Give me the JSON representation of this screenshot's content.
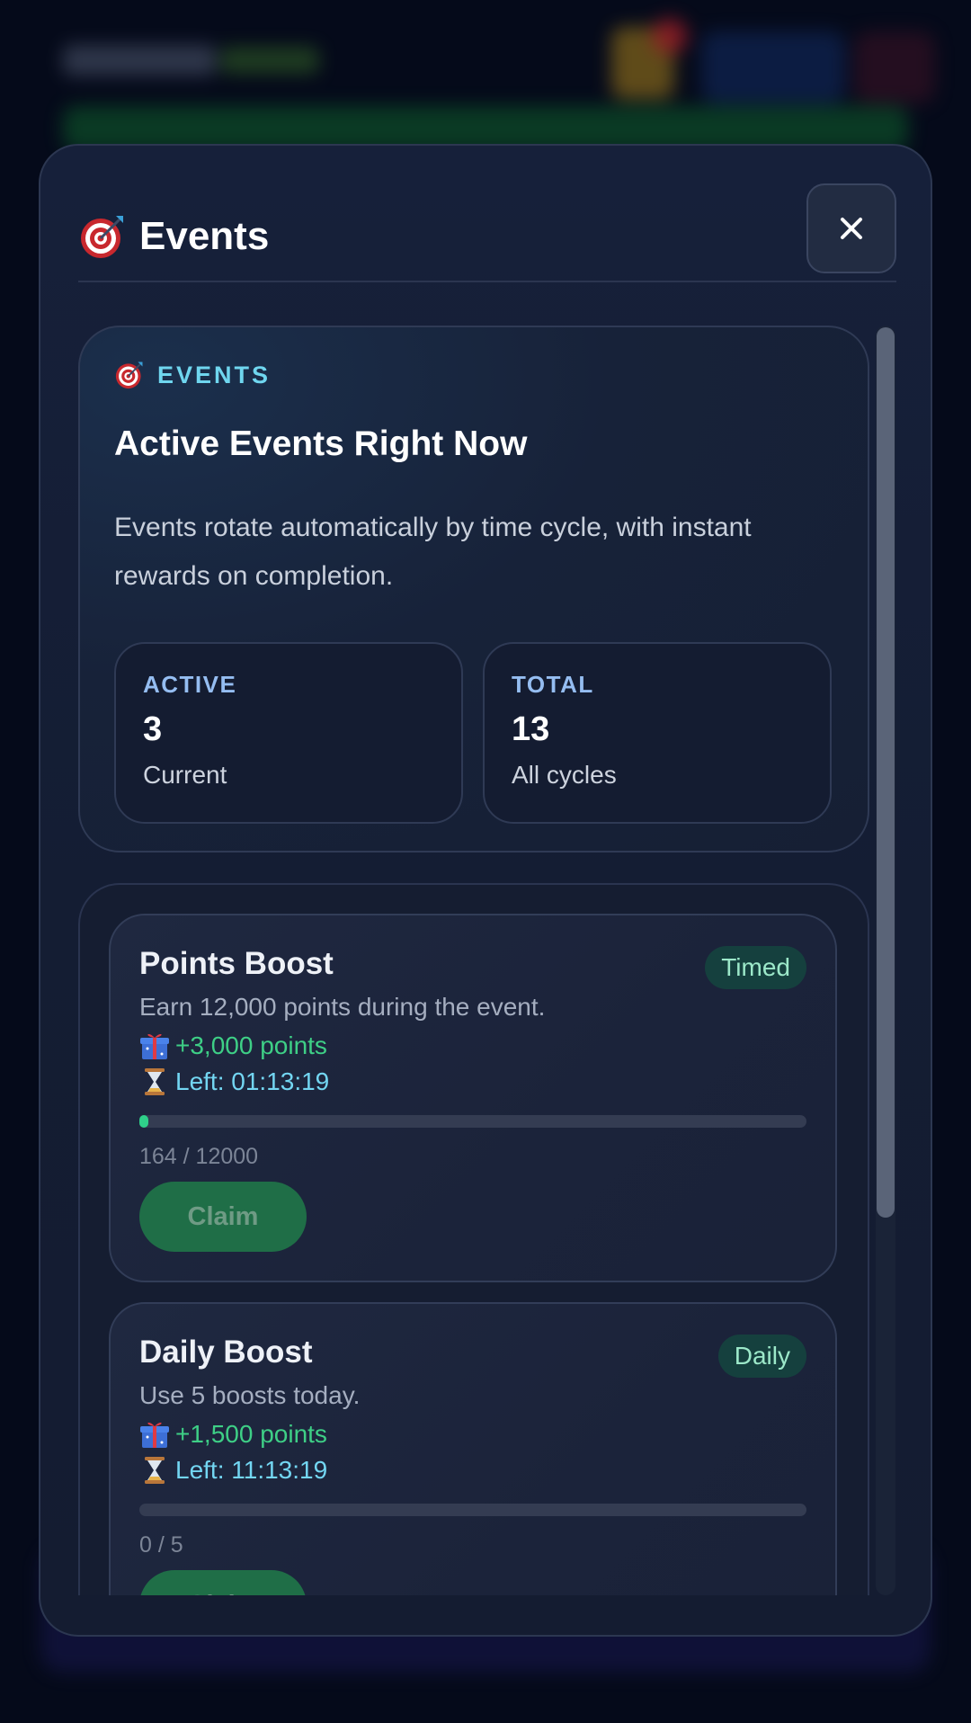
{
  "modal": {
    "title": "Events",
    "close_label": "✕"
  },
  "hero": {
    "kicker": "EVENTS",
    "title": "Active Events Right Now",
    "description": "Events rotate automatically by time cycle, with instant rewards on completion.",
    "stats": [
      {
        "label": "ACTIVE",
        "value": "3",
        "sub": "Current"
      },
      {
        "label": "TOTAL",
        "value": "13",
        "sub": "All cycles"
      }
    ]
  },
  "events": [
    {
      "name": "Points Boost",
      "badge": "Timed",
      "description": "Earn 12,000 points during the event.",
      "reward": "+3,000 points",
      "time_left": "Left: 01:13:19",
      "progress_text": "164 / 12000",
      "progress_fraction": 0.0137,
      "claim_label": "Claim"
    },
    {
      "name": "Daily Boost",
      "badge": "Daily",
      "description": "Use 5 boosts today.",
      "reward": "+1,500 points",
      "time_left": "Left: 11:13:19",
      "progress_text": "0 / 5",
      "progress_fraction": 0,
      "claim_label": "Claim"
    }
  ],
  "icons": {
    "title": "target-icon",
    "reward": "gift-icon",
    "time": "hourglass-icon",
    "close": "close-icon"
  },
  "colors": {
    "accent_cyan": "#6fd6ef",
    "reward_green": "#3ecf86",
    "claim_button": "#1f6e47",
    "badge_bg": "#15403e"
  }
}
